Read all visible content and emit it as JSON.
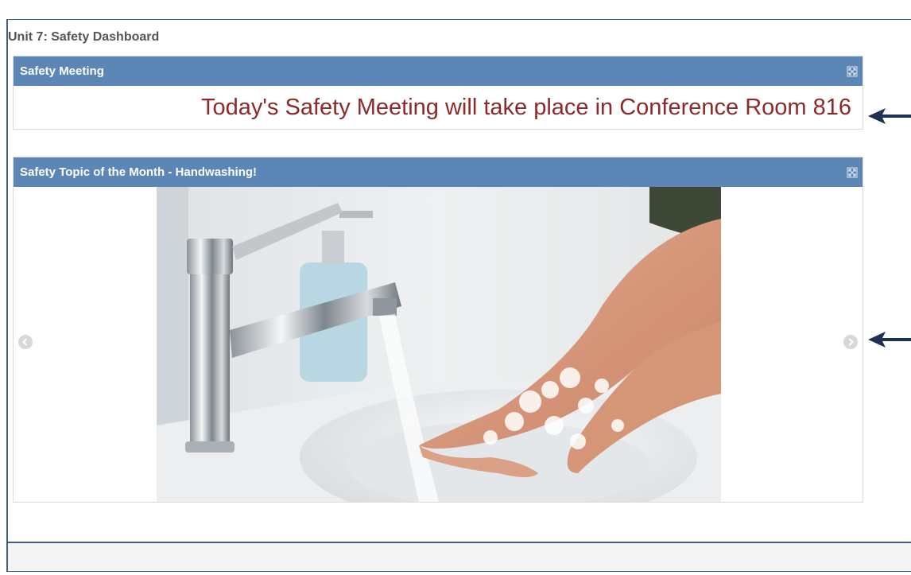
{
  "dashboard": {
    "title": "Unit 7: Safety Dashboard"
  },
  "meeting_panel": {
    "title": "Safety Meeting",
    "message": "Today's Safety Meeting will take place in Conference Room 816",
    "expand_icon": "expand-icon"
  },
  "topic_panel": {
    "title": "Safety Topic of the Month - Handwashing!",
    "expand_icon": "expand-icon",
    "slide_image": "handwashing-photo",
    "prev_icon": "chevron-left-icon",
    "next_icon": "chevron-right-icon"
  },
  "colors": {
    "panel_header": "#5b86b5",
    "meeting_text": "#8c2a2a",
    "frame_border": "#41607f",
    "callout_arrow": "#1c3153"
  }
}
